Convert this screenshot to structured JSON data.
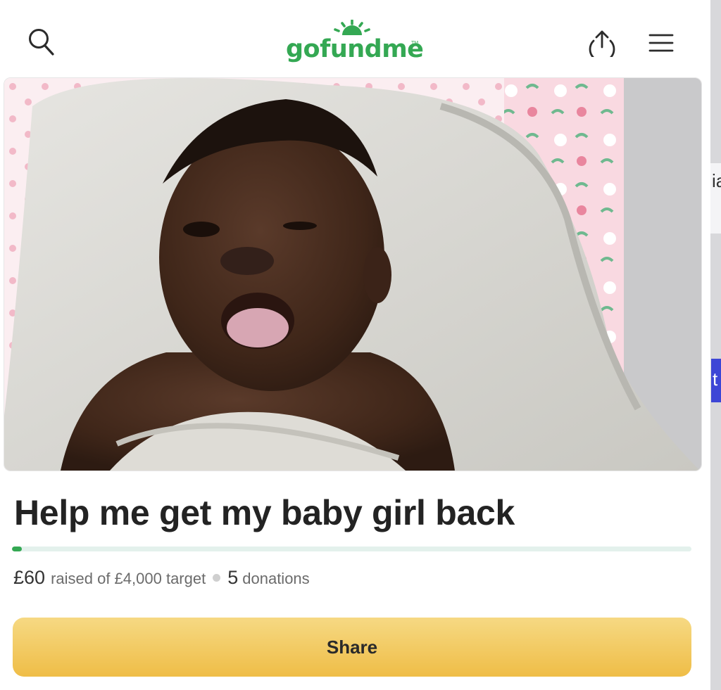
{
  "header": {
    "logo_text": "gofundme",
    "logo_tm": "TM",
    "icons": [
      "search-icon",
      "share-upload-icon",
      "hamburger-menu-icon"
    ],
    "brand_color": "#34a853"
  },
  "hero": {
    "image_alt": "Photo of a smiling baby wrapped in a grey towel"
  },
  "campaign": {
    "title": "Help me get my baby girl back",
    "raised": "£60",
    "raised_text": "raised of £4,000 target",
    "donations_count": "5",
    "donations_label": "donations",
    "progress_fraction": 0.015,
    "progress_color": "#34a853"
  },
  "actions": {
    "share_label": "Share",
    "share_color": "#f2c75c"
  },
  "edge": {
    "panel_text": "ia",
    "chip_text": "t",
    "chip_color": "#3d46d6"
  }
}
